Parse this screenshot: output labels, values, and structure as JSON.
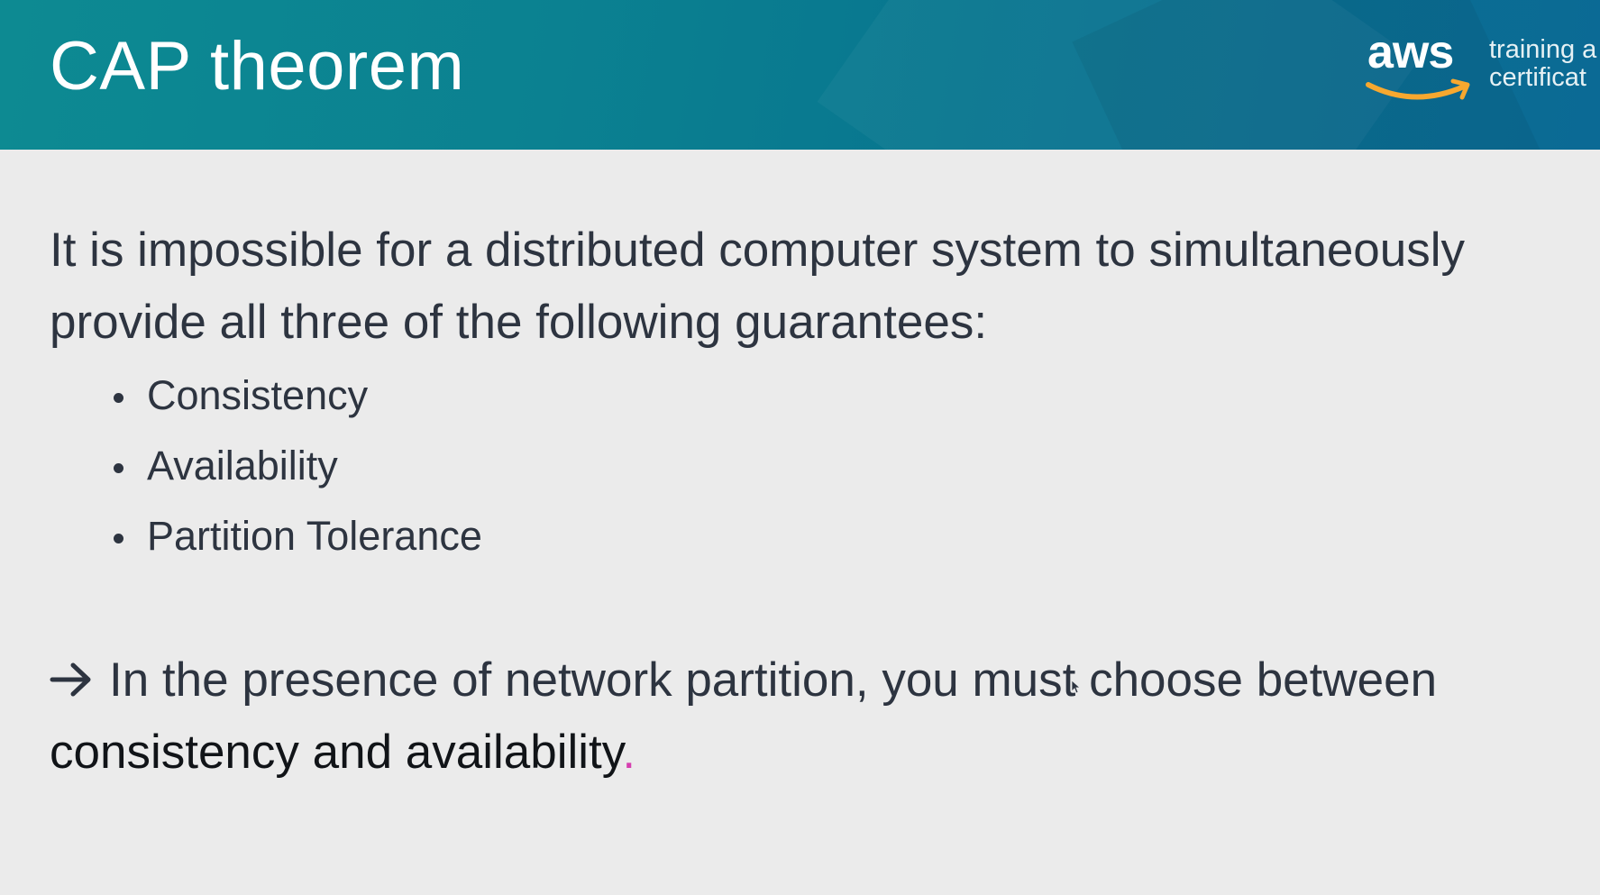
{
  "header": {
    "title": "CAP theorem",
    "logo": {
      "wordmark": "aws",
      "tagline_line1": "training a",
      "tagline_line2": "certificat",
      "smile_color": "#f7a82f"
    },
    "background_color": "#0a7c90"
  },
  "content": {
    "intro_line1": "It is impossible for a distributed computer system to simultaneously",
    "intro_line2": "provide all three of the following guarantees:",
    "bullets": [
      "Consistency",
      "Availability",
      "Partition Tolerance"
    ],
    "conclusion_line1": "In the presence of network partition, you must choose between",
    "conclusion_line2": "consistency and availability",
    "conclusion_end": ".",
    "arrow_icon": "right-arrow-icon"
  },
  "colors": {
    "text": "#2d3440",
    "slide_background": "#ebebeb",
    "accent_dot": "#d63fb0"
  }
}
